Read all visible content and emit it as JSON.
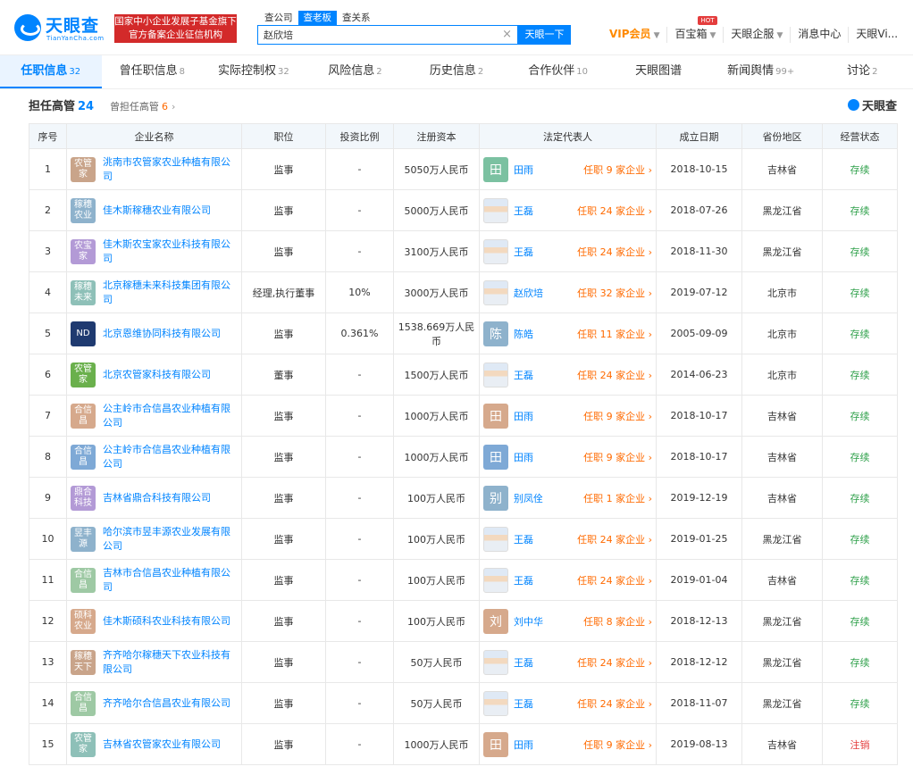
{
  "header": {
    "logo_cn": "天眼查",
    "logo_en": "TianYanCha.com",
    "banner_line1": "国家中小企业发展子基金旗下",
    "banner_line2": "官方备案企业征信机构",
    "search_tabs": [
      "查公司",
      "查老板",
      "查关系"
    ],
    "search_value": "赵欣培",
    "search_clear": "×",
    "search_button": "天眼一下",
    "nav": {
      "vip": "VIP会员",
      "baibaoxiang": "百宝箱",
      "hot": "HOT",
      "tianyan_qiye": "天眼企服",
      "messages": "消息中心",
      "user": "天眼Vi..."
    }
  },
  "cat_tabs": [
    {
      "label": "任职信息",
      "count": "32"
    },
    {
      "label": "曾任职信息",
      "count": "8"
    },
    {
      "label": "实际控制权",
      "count": "32"
    },
    {
      "label": "风险信息",
      "count": "2"
    },
    {
      "label": "历史信息",
      "count": "2"
    },
    {
      "label": "合作伙伴",
      "count": "10"
    },
    {
      "label": "天眼图谱",
      "count": ""
    },
    {
      "label": "新闻舆情",
      "count": "99+"
    },
    {
      "label": "讨论",
      "count": "2"
    }
  ],
  "section": {
    "title": "担任高管",
    "title_count": "24",
    "sub": "曾担任高管",
    "sub_count": "6",
    "brand": "天眼查"
  },
  "table": {
    "headers": [
      "序号",
      "企业名称",
      "职位",
      "投资比例",
      "注册资本",
      "法定代表人",
      "成立日期",
      "省份地区",
      "经营状态"
    ],
    "rows": [
      {
        "no": "1",
        "logo_text": "农管家",
        "logo_color": "#c9a48a",
        "company": "洮南市农管家农业种植有限公司",
        "position": "监事",
        "ratio": "-",
        "capital": "5050万人民币",
        "rep_avatar": "田",
        "rep_color": "#7bc1a1",
        "rep": "田雨",
        "rep_roles": "任职 9 家企业",
        "date": "2018-10-15",
        "region": "吉林省",
        "status": "存续"
      },
      {
        "no": "2",
        "logo_text": "稼穗农业",
        "logo_color": "#8eb2cc",
        "company": "佳木斯稼穗农业有限公司",
        "position": "监事",
        "ratio": "-",
        "capital": "5000万人民币",
        "rep_avatar": "",
        "rep_color": "",
        "rep": "王磊",
        "rep_roles": "任职 24 家企业",
        "date": "2018-07-26",
        "region": "黑龙江省",
        "status": "存续"
      },
      {
        "no": "3",
        "logo_text": "农宝家",
        "logo_color": "#b39ad6",
        "company": "佳木斯农宝家农业科技有限公司",
        "position": "监事",
        "ratio": "-",
        "capital": "3100万人民币",
        "rep_avatar": "",
        "rep_color": "",
        "rep": "王磊",
        "rep_roles": "任职 24 家企业",
        "date": "2018-11-30",
        "region": "黑龙江省",
        "status": "存续"
      },
      {
        "no": "4",
        "logo_text": "稼穗未来",
        "logo_color": "#8ec0b8",
        "company": "北京稼穗未来科技集团有限公司",
        "position": "经理,执行董事",
        "ratio": "10%",
        "capital": "3000万人民币",
        "rep_avatar": "",
        "rep_color": "",
        "rep": "赵欣培",
        "rep_roles": "任职 32 家企业",
        "date": "2019-07-12",
        "region": "北京市",
        "status": "存续"
      },
      {
        "no": "5",
        "logo_text": "ND",
        "logo_color": "#1f3a70",
        "company": "北京恩维协同科技有限公司",
        "position": "监事",
        "ratio": "0.361%",
        "capital": "1538.669万人民币",
        "rep_avatar": "陈",
        "rep_color": "#8eb2cc",
        "rep": "陈皓",
        "rep_roles": "任职 11 家企业",
        "date": "2005-09-09",
        "region": "北京市",
        "status": "存续"
      },
      {
        "no": "6",
        "logo_text": "农管家",
        "logo_color": "#6ab04c",
        "company": "北京农管家科技有限公司",
        "position": "董事",
        "ratio": "-",
        "capital": "1500万人民币",
        "rep_avatar": "",
        "rep_color": "",
        "rep": "王磊",
        "rep_roles": "任职 24 家企业",
        "date": "2014-06-23",
        "region": "北京市",
        "status": "存续"
      },
      {
        "no": "7",
        "logo_text": "合信昌",
        "logo_color": "#d6a98c",
        "company": "公主岭市合信昌农业种植有限公司",
        "position": "监事",
        "ratio": "-",
        "capital": "1000万人民币",
        "rep_avatar": "田",
        "rep_color": "#d6a98c",
        "rep": "田雨",
        "rep_roles": "任职 9 家企业",
        "date": "2018-10-17",
        "region": "吉林省",
        "status": "存续"
      },
      {
        "no": "8",
        "logo_text": "合信昌",
        "logo_color": "#7ea9d6",
        "company": "公主岭市合信昌农业种植有限公司",
        "position": "监事",
        "ratio": "-",
        "capital": "1000万人民币",
        "rep_avatar": "田",
        "rep_color": "#7ea9d6",
        "rep": "田雨",
        "rep_roles": "任职 9 家企业",
        "date": "2018-10-17",
        "region": "吉林省",
        "status": "存续"
      },
      {
        "no": "9",
        "logo_text": "鼎合科技",
        "logo_color": "#b39ad6",
        "company": "吉林省鼎合科技有限公司",
        "position": "监事",
        "ratio": "-",
        "capital": "100万人民币",
        "rep_avatar": "别",
        "rep_color": "#8eb2cc",
        "rep": "别凤佺",
        "rep_roles": "任职 1 家企业",
        "date": "2019-12-19",
        "region": "吉林省",
        "status": "存续"
      },
      {
        "no": "10",
        "logo_text": "昱丰源",
        "logo_color": "#8eb2cc",
        "company": "哈尔滨市昱丰源农业发展有限公司",
        "position": "监事",
        "ratio": "-",
        "capital": "100万人民币",
        "rep_avatar": "",
        "rep_color": "",
        "rep": "王磊",
        "rep_roles": "任职 24 家企业",
        "date": "2019-01-25",
        "region": "黑龙江省",
        "status": "存续"
      },
      {
        "no": "11",
        "logo_text": "合信昌",
        "logo_color": "#9ec9a4",
        "company": "吉林市合信昌农业种植有限公司",
        "position": "监事",
        "ratio": "-",
        "capital": "100万人民币",
        "rep_avatar": "",
        "rep_color": "",
        "rep": "王磊",
        "rep_roles": "任职 24 家企业",
        "date": "2019-01-04",
        "region": "吉林省",
        "status": "存续"
      },
      {
        "no": "12",
        "logo_text": "硕科农业",
        "logo_color": "#d6a98c",
        "company": "佳木斯硕科农业科技有限公司",
        "position": "监事",
        "ratio": "-",
        "capital": "100万人民币",
        "rep_avatar": "刘",
        "rep_color": "#d6a98c",
        "rep": "刘中华",
        "rep_roles": "任职 8 家企业",
        "date": "2018-12-13",
        "region": "黑龙江省",
        "status": "存续"
      },
      {
        "no": "13",
        "logo_text": "稼穗天下",
        "logo_color": "#c9a48a",
        "company": "齐齐哈尔稼穗天下农业科技有限公司",
        "position": "监事",
        "ratio": "-",
        "capital": "50万人民币",
        "rep_avatar": "",
        "rep_color": "",
        "rep": "王磊",
        "rep_roles": "任职 24 家企业",
        "date": "2018-12-12",
        "region": "黑龙江省",
        "status": "存续"
      },
      {
        "no": "14",
        "logo_text": "合信昌",
        "logo_color": "#9ec9a4",
        "company": "齐齐哈尔合信昌农业有限公司",
        "position": "监事",
        "ratio": "-",
        "capital": "50万人民币",
        "rep_avatar": "",
        "rep_color": "",
        "rep": "王磊",
        "rep_roles": "任职 24 家企业",
        "date": "2018-11-07",
        "region": "黑龙江省",
        "status": "存续"
      },
      {
        "no": "15",
        "logo_text": "农管家",
        "logo_color": "#8ec0b8",
        "company": "吉林省农管家农业有限公司",
        "position": "监事",
        "ratio": "-",
        "capital": "1000万人民币",
        "rep_avatar": "田",
        "rep_color": "#d6a98c",
        "rep": "田雨",
        "rep_roles": "任职 9 家企业",
        "date": "2019-08-13",
        "region": "吉林省",
        "status": "注销"
      }
    ]
  },
  "colors": {
    "accent": "#0084ff",
    "orange": "#ff6a00",
    "active_status": "#2ea04a",
    "closed_status": "#e43d3d"
  }
}
